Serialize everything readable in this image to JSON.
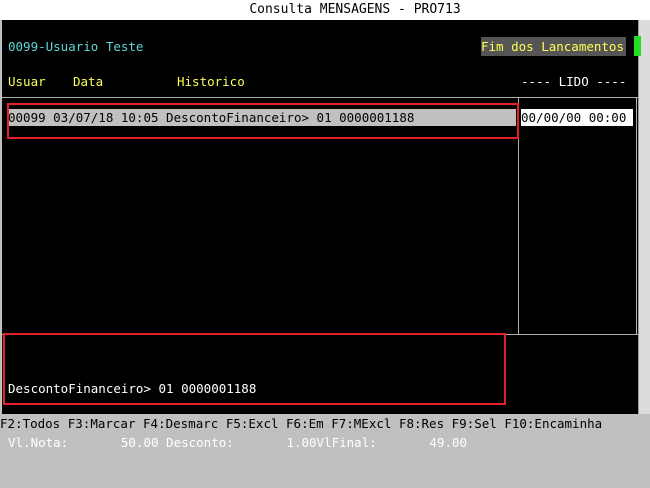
{
  "window": {
    "title": "Consulta MENSAGENS - PRO713"
  },
  "header": {
    "user_label": "0099-Usuario Teste",
    "status_badge": "Fim dos Lancamentos"
  },
  "columns": {
    "user": "Usuar",
    "date": "Data",
    "history": "Historico",
    "lido": "---- LIDO ----"
  },
  "messages": [
    {
      "line": "00099 03/07/18 10:05 DescontoFinanceiro> 01 0000001188",
      "lido": "00/00/00 00:00"
    }
  ],
  "detail": {
    "line1": "DescontoFinanceiro> 01 0000001188",
    "line2": "Vl.Nota:       50.00 Desconto:       1.00VlFinal:       49.00"
  },
  "function_keys": [
    "F2:Todos",
    "F3:Marcar",
    "F4:Desmarc",
    "F5:Excl",
    "F6:Em",
    "F7:MExcl",
    "F8:Res",
    "F9:Sel",
    "F10:Encaminha"
  ],
  "colors": {
    "screen_bg": "#000000",
    "header_cyan": "#5fd7d7",
    "column_yellow": "#ffff55",
    "selection_bg": "#c0c0c0",
    "annotation_red": "#e3202a",
    "cursor_green": "#22dd22"
  }
}
